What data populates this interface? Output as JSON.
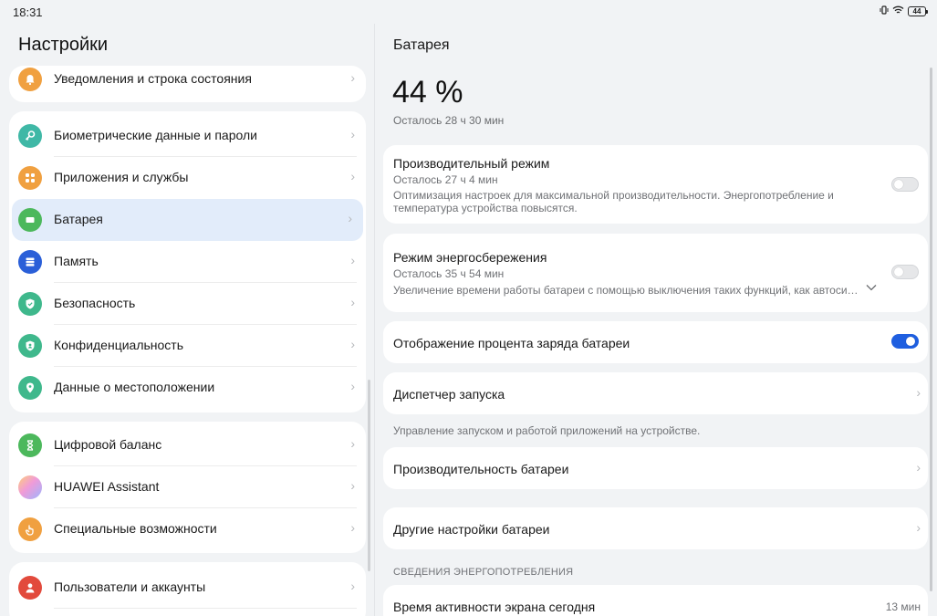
{
  "status_bar": {
    "time": "18:31",
    "battery_level": "44",
    "icons": [
      "vibrate-icon",
      "wifi-icon",
      "battery-icon"
    ]
  },
  "left": {
    "title": "Настройки",
    "groups": [
      {
        "items": [
          {
            "label": "Уведомления и строка состояния",
            "icon": "bell-icon",
            "color": "#f0a040"
          }
        ]
      },
      {
        "items": [
          {
            "label": "Биометрические данные и пароли",
            "icon": "key-icon",
            "color": "#3fb8a6"
          },
          {
            "label": "Приложения и службы",
            "icon": "apps-icon",
            "color": "#f0a040"
          },
          {
            "label": "Батарея",
            "icon": "battery-icon",
            "color": "#4cb85c",
            "selected": true
          },
          {
            "label": "Память",
            "icon": "storage-icon",
            "color": "#2a5fd8"
          },
          {
            "label": "Безопасность",
            "icon": "shield-icon",
            "color": "#3fb88c"
          },
          {
            "label": "Конфиденциальность",
            "icon": "privacy-shield-icon",
            "color": "#3fb88c"
          },
          {
            "label": "Данные о местоположении",
            "icon": "location-pin-icon",
            "color": "#3fb88c"
          }
        ]
      },
      {
        "items": [
          {
            "label": "Цифровой баланс",
            "icon": "hourglass-icon",
            "color": "#4cb85c"
          },
          {
            "label": "HUAWEI Assistant",
            "icon": "assistant-icon",
            "color": "#c890e0"
          },
          {
            "label": "Специальные возможности",
            "icon": "hand-icon",
            "color": "#f0a040"
          }
        ]
      },
      {
        "items": [
          {
            "label": "Пользователи и аккаунты",
            "icon": "user-icon",
            "color": "#e24a3c"
          }
        ]
      }
    ]
  },
  "right": {
    "title": "Батарея",
    "percent": "44 %",
    "remaining": "Осталось 28 ч 30 мин",
    "performance_mode": {
      "title": "Производительный режим",
      "sub": "Осталось 27 ч 4 мин",
      "desc": "Оптимизация настроек для максимальной производительности. Энергопотребление и температура устройства повысятся.",
      "enabled": false
    },
    "power_saving": {
      "title": "Режим энергосбережения",
      "sub": "Осталось 35 ч 54 мин",
      "desc": "Увеличение времени работы батареи с помощью выключения таких функций, как автоси…",
      "enabled": false
    },
    "show_percentage": {
      "title": "Отображение процента заряда батареи",
      "enabled": true
    },
    "launch_manager": {
      "title": "Диспетчер запуска",
      "note": "Управление запуском и работой приложений на устройстве."
    },
    "battery_performance": {
      "title": "Производительность батареи"
    },
    "other_settings": {
      "title": "Другие настройки батареи"
    },
    "power_section_header": "СВЕДЕНИЯ ЭНЕРГОПОТРЕБЛЕНИЯ",
    "screen_on_time": {
      "title": "Время активности экрана сегодня",
      "value": "13 мин"
    },
    "colors": {
      "accent": "#1f5fe0",
      "selected_bg": "#e2ecfa"
    }
  }
}
